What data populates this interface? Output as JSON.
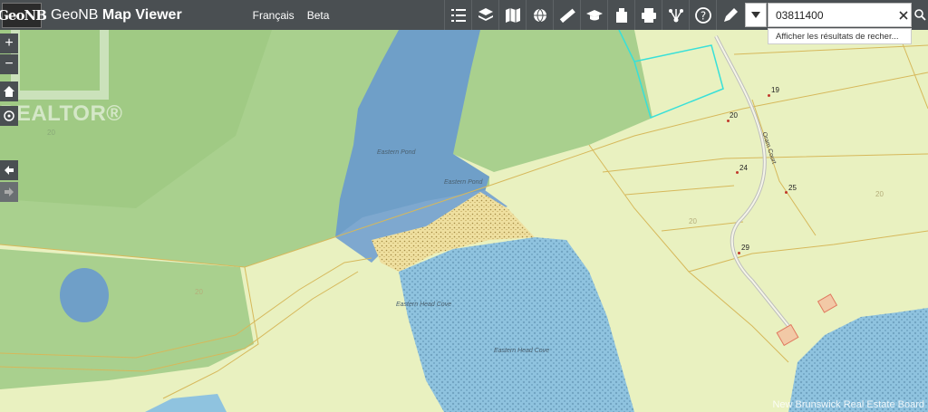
{
  "header": {
    "logo_text": "GeoNB",
    "title_prefix": "GeoNB",
    "title_main": "Map Viewer",
    "link_french": "Français",
    "link_beta": "Beta"
  },
  "toolbar": {
    "icons": [
      "list-icon",
      "layers-icon",
      "basemap-icon",
      "bookmark-globe-icon",
      "measure-icon",
      "education-icon",
      "print-layout-icon",
      "print-icon",
      "share-icon",
      "help-icon",
      "draw-icon"
    ]
  },
  "search": {
    "value": "03811400",
    "suggestion": "Afficher les résultats de recher..."
  },
  "map": {
    "labels": {
      "pond_upper": "Eastern Pond",
      "pond_mid": "Eastern Pond",
      "cove": "Eastern Head Cove",
      "water_lower": "Eastern Head Cove",
      "road": "Oram Court"
    },
    "civic_numbers": [
      "19",
      "20",
      "24",
      "25",
      "29"
    ],
    "parcel_text": [
      "20",
      "20",
      "20",
      "20"
    ]
  },
  "watermark": "REALTOR®",
  "credit": "New Brunswick Real Estate Board",
  "colors": {
    "topbar": "#4a4f52",
    "forest": "#a9d08e",
    "open_land": "#e9f1c0",
    "water_pond": "#6f9fc8",
    "water_tidal": "#8fc3df",
    "parcel_line": "#d6b85a",
    "selected_parcel": "#38e0d8"
  }
}
